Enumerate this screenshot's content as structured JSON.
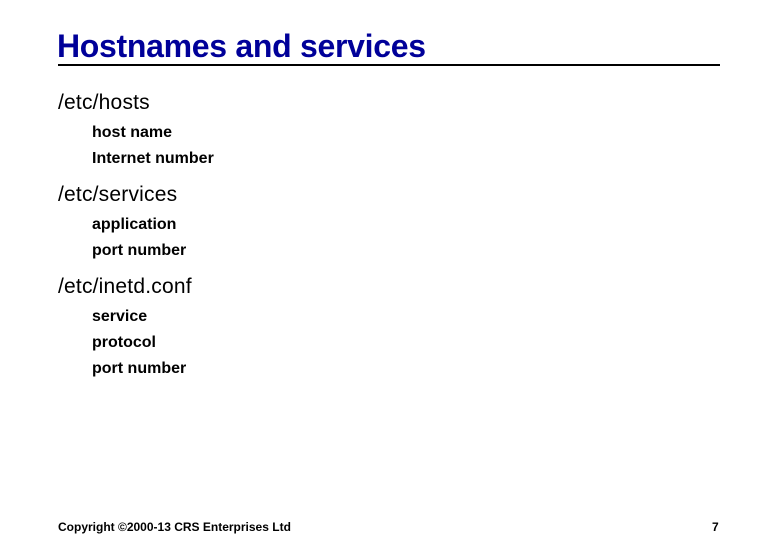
{
  "slide": {
    "title": "Hostnames and services",
    "title_color": "#000099",
    "sections": [
      {
        "heading": "/etc/hosts",
        "items": [
          "host name",
          "Internet number"
        ]
      },
      {
        "heading": "/etc/services",
        "items": [
          "application",
          "port number"
        ]
      },
      {
        "heading": "/etc/inetd.conf",
        "items": [
          "service",
          "protocol",
          "port number"
        ]
      }
    ]
  },
  "footer": {
    "copyright": "Copyright ©2000-13 CRS Enterprises Ltd",
    "page_number": "7"
  }
}
